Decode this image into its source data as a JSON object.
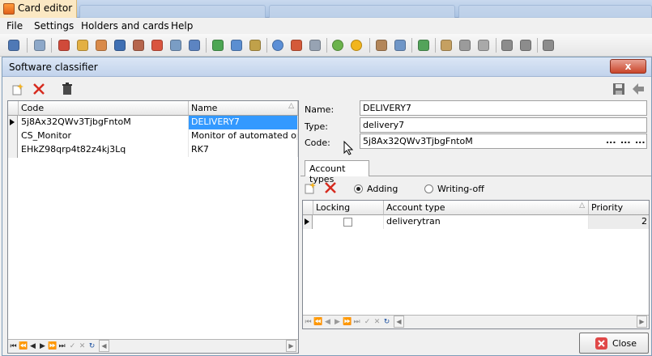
{
  "app": {
    "title": "Card editor"
  },
  "menu": [
    "File",
    "Settings",
    "Holders and cards",
    "Help"
  ],
  "dialog": {
    "title": "Software classifier",
    "close_glyph": "x"
  },
  "left_grid": {
    "columns": [
      "Code",
      "Name"
    ],
    "rows": [
      {
        "code": "5j8Ax32QWv3TjbgFntoM",
        "name": "DELIVERY7"
      },
      {
        "code": "CS_Monitor",
        "name": "Monitor of automated opera"
      },
      {
        "code": "EHkZ98qrp4t82z4kj3Lq",
        "name": "RK7"
      }
    ]
  },
  "form": {
    "name_label": "Name:",
    "name_value": "DELIVERY7",
    "type_label": "Type:",
    "type_value": "delivery7",
    "code_label": "Code:",
    "code_value": "5j8Ax32QWv3TjbgFntoM",
    "dots": "..."
  },
  "account_tab": {
    "label": "Account types"
  },
  "radios": {
    "adding": "Adding",
    "writing_off": "Writing-off",
    "selected": "adding"
  },
  "right_grid": {
    "columns": [
      "Locking",
      "Account type",
      "Priority"
    ],
    "rows": [
      {
        "locking": false,
        "account_type": "deliverytran",
        "priority": "2"
      }
    ]
  },
  "buttons": {
    "close": "Close"
  },
  "colors": {
    "selection": "#3399ff",
    "delete": "#d62b1f",
    "close_icon": "#e04848"
  },
  "icons": {
    "add": "add-record-icon",
    "delete": "delete-x-icon",
    "trash": "trash-icon",
    "save": "save-icon",
    "back": "back-arrow-icon"
  }
}
